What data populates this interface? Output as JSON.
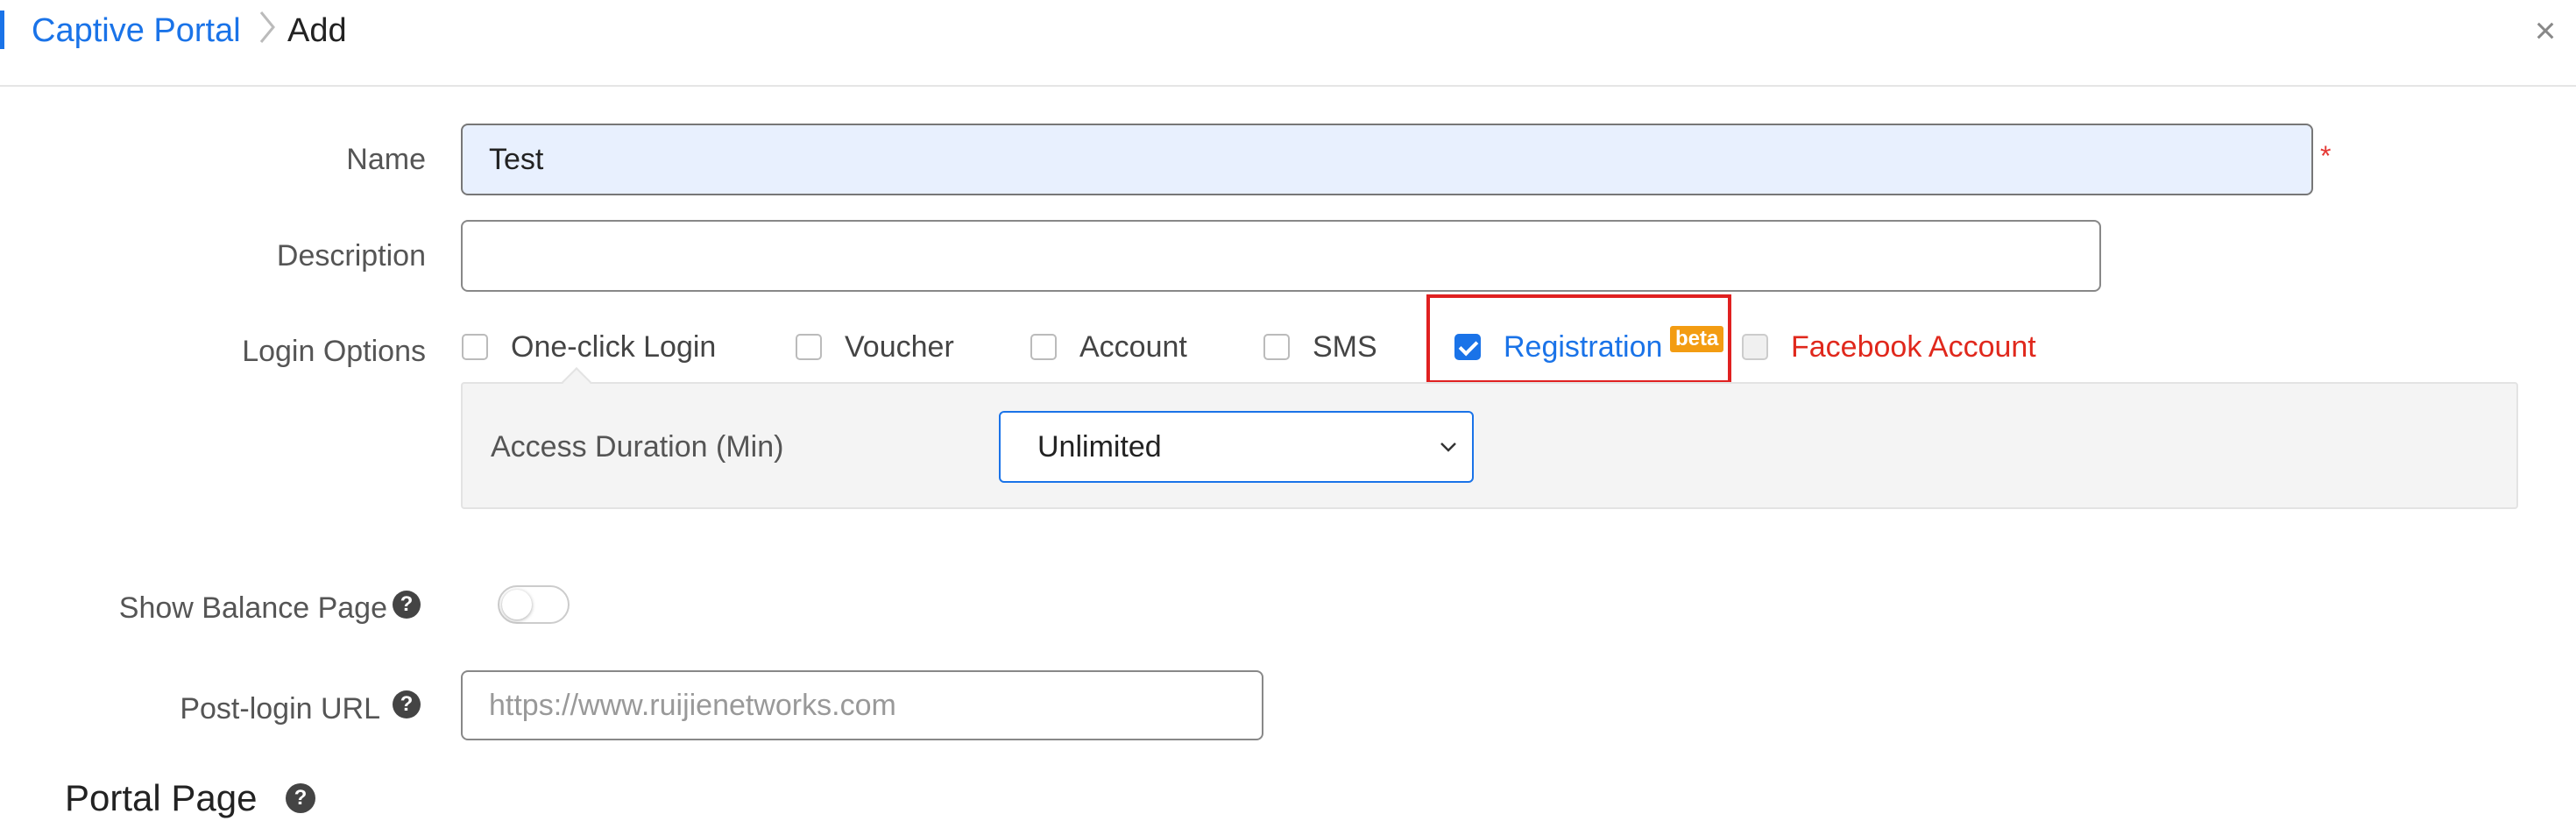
{
  "breadcrumb": {
    "parent": "Captive Portal",
    "current": "Add"
  },
  "header": {
    "close_icon": "×"
  },
  "form": {
    "name": {
      "label": "Name",
      "value": "Test",
      "required_mark": "*"
    },
    "description": {
      "label": "Description",
      "value": "",
      "placeholder": ""
    },
    "login_options": {
      "label": "Login Options",
      "items": [
        {
          "label": "One-click Login",
          "checked": false
        },
        {
          "label": "Voucher",
          "checked": false
        },
        {
          "label": "Account",
          "checked": false
        },
        {
          "label": "SMS",
          "checked": false
        },
        {
          "label": "Registration",
          "checked": true,
          "badge": "beta"
        },
        {
          "label": "Facebook Account",
          "checked": false,
          "disabled": true
        }
      ]
    },
    "access_duration": {
      "label": "Access Duration (Min)",
      "value": "Unlimited"
    },
    "show_balance_page": {
      "label": "Show Balance Page",
      "enabled": false,
      "help_icon": "?"
    },
    "post_login_url": {
      "label": "Post-login URL",
      "value": "",
      "placeholder": "https://www.ruijienetworks.com",
      "help_icon": "?"
    }
  },
  "portal_page": {
    "title": "Portal Page",
    "help_icon": "?"
  },
  "colors": {
    "accent": "#1a73e8",
    "danger": "#e0281c",
    "beta_badge": "#f39c12",
    "filled_input": "#e8f0fe"
  }
}
